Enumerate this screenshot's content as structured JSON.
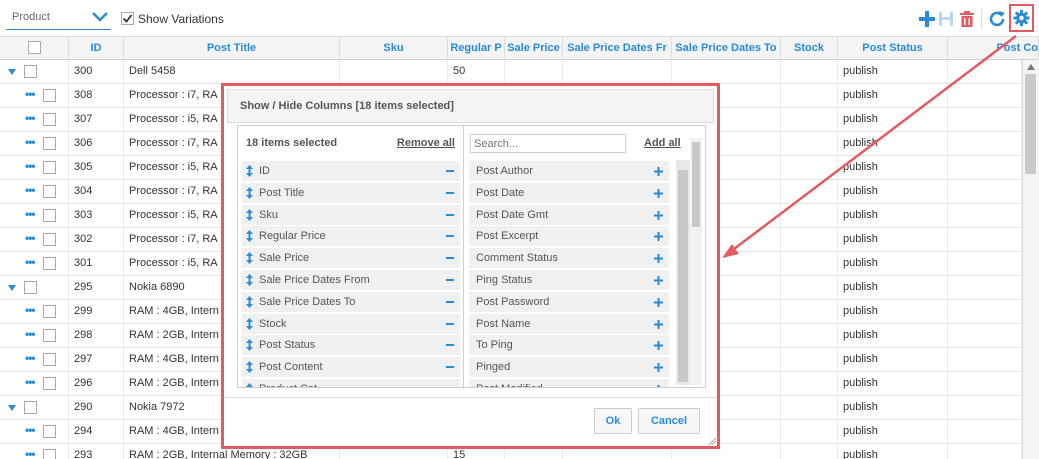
{
  "toolbar": {
    "post_type": "Product",
    "show_variations_label": "Show Variations",
    "show_variations_checked": true,
    "icons": [
      "plus-icon",
      "save-icon",
      "trash-icon",
      "refresh-icon",
      "gear-icon"
    ],
    "accent": "#2b8ad6",
    "danger": "#e35b60"
  },
  "grid": {
    "columns": [
      "",
      "ID",
      "Post Title",
      "Sku",
      "Regular P",
      "Sale Price",
      "Sale Price Dates Fr",
      "Sale Price Dates To",
      "Stock",
      "Post Status",
      "Post Co"
    ],
    "rows": [
      {
        "kind": "parent",
        "id": "300",
        "title": "Dell 5458",
        "regular": "50",
        "status": "publish"
      },
      {
        "kind": "child",
        "id": "308",
        "title": "Processor : i7, RA",
        "regular": "",
        "status": "publish"
      },
      {
        "kind": "child",
        "id": "307",
        "title": "Processor : i5, RA",
        "regular": "",
        "status": "publish"
      },
      {
        "kind": "child",
        "id": "306",
        "title": "Processor : i7, RA",
        "regular": "",
        "status": "publish"
      },
      {
        "kind": "child",
        "id": "305",
        "title": "Processor : i5, RA",
        "regular": "",
        "status": "publish"
      },
      {
        "kind": "child",
        "id": "304",
        "title": "Processor : i7, RA",
        "regular": "",
        "status": "publish"
      },
      {
        "kind": "child",
        "id": "303",
        "title": "Processor : i5, RA",
        "regular": "",
        "status": "publish"
      },
      {
        "kind": "child",
        "id": "302",
        "title": "Processor : i7, RA",
        "regular": "",
        "status": "publish"
      },
      {
        "kind": "child",
        "id": "301",
        "title": "Processor : i5, RA",
        "regular": "",
        "status": "publish"
      },
      {
        "kind": "parent",
        "id": "295",
        "title": "Nokia 6890",
        "regular": "",
        "status": "publish"
      },
      {
        "kind": "child",
        "id": "299",
        "title": "RAM : 4GB, Intern",
        "regular": "",
        "status": "publish"
      },
      {
        "kind": "child",
        "id": "298",
        "title": "RAM : 2GB, Intern",
        "regular": "",
        "status": "publish"
      },
      {
        "kind": "child",
        "id": "297",
        "title": "RAM : 4GB, Intern",
        "regular": "",
        "status": "publish"
      },
      {
        "kind": "child",
        "id": "296",
        "title": "RAM : 2GB, Intern",
        "regular": "",
        "status": "publish"
      },
      {
        "kind": "parent",
        "id": "290",
        "title": "Nokia 7972",
        "regular": "",
        "status": "publish"
      },
      {
        "kind": "child",
        "id": "294",
        "title": "RAM : 4GB, Intern",
        "regular": "",
        "status": "publish"
      },
      {
        "kind": "child",
        "id": "293",
        "title": "RAM : 2GB, Internal Memory : 32GB",
        "regular": "15",
        "status": "publish"
      }
    ]
  },
  "modal": {
    "title": "Show / Hide Columns [18 items selected]",
    "selected_label": "18 items selected",
    "remove_all": "Remove all",
    "search_placeholder": "Search...",
    "add_all": "Add all",
    "selected_columns": [
      "ID",
      "Post Title",
      "Sku",
      "Regular Price",
      "Sale Price",
      "Sale Price Dates From",
      "Sale Price Dates To",
      "Stock",
      "Post Status",
      "Post Content",
      "Product Cat"
    ],
    "available_columns": [
      "Post Author",
      "Post Date",
      "Post Date Gmt",
      "Post Excerpt",
      "Comment Status",
      "Ping Status",
      "Post Password",
      "Post Name",
      "To Ping",
      "Pinged",
      "Post Modified"
    ],
    "ok_label": "Ok",
    "cancel_label": "Cancel"
  }
}
